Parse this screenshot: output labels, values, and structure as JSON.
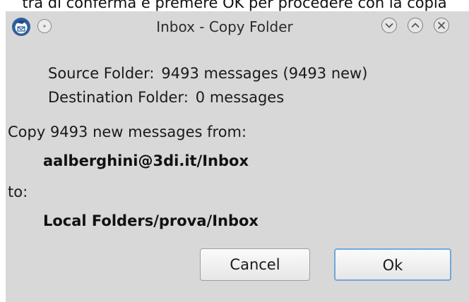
{
  "caption": "tra di conferma e premere OK per procedere con la copia",
  "window": {
    "title": "Inbox - Copy Folder",
    "icon": "thunderbird-icon",
    "menu_icon": "window-menu-icon",
    "controls": [
      "minimize-icon",
      "maximize-icon",
      "close-icon"
    ]
  },
  "info": {
    "source_label": "Source Folder:",
    "source_value": "9493 messages (9493 new)",
    "dest_label": "Destination Folder:",
    "dest_value": "0 messages"
  },
  "copy": {
    "intro": "Copy 9493 new messages from:",
    "from_folder": "aalberghini@3di.it/Inbox",
    "to_label": "to:",
    "to_folder": "Local Folders/prova/Inbox"
  },
  "buttons": {
    "cancel": "Cancel",
    "ok": "Ok"
  }
}
